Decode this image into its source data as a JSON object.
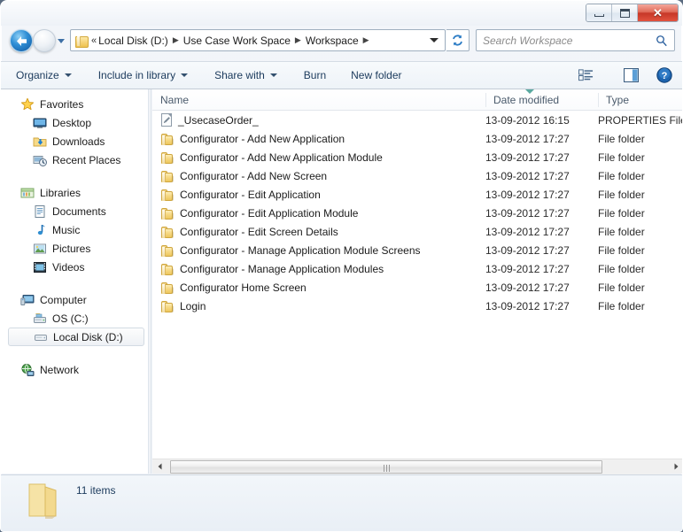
{
  "window": {
    "controls": {
      "minimize": "Minimize",
      "maximize": "Maximize",
      "close": "Close",
      "close_glyph": "✕"
    }
  },
  "address_bar": {
    "back_tooltip": "Back",
    "forward_tooltip": "Forward",
    "overflow_glyph": "«",
    "crumbs": [
      "Local Disk (D:)",
      "Use Case Work Space",
      "Workspace"
    ],
    "separator": "▶",
    "refresh_tooltip": "Refresh"
  },
  "search": {
    "placeholder": "Search Workspace"
  },
  "toolbar": {
    "items": [
      {
        "label": "Organize",
        "has_caret": true
      },
      {
        "label": "Include in library",
        "has_caret": true
      },
      {
        "label": "Share with",
        "has_caret": true
      },
      {
        "label": "Burn",
        "has_caret": false
      },
      {
        "label": "New folder",
        "has_caret": false
      }
    ],
    "view_button": "Change your view",
    "preview_button": "Show the preview pane",
    "help_button": "Get help"
  },
  "nav_pane": {
    "groups": [
      {
        "header": {
          "label": "Favorites",
          "icon": "star-icon"
        },
        "items": [
          {
            "label": "Desktop",
            "icon": "desktop-icon"
          },
          {
            "label": "Downloads",
            "icon": "downloads-icon"
          },
          {
            "label": "Recent Places",
            "icon": "recent-places-icon"
          }
        ]
      },
      {
        "header": {
          "label": "Libraries",
          "icon": "libraries-icon"
        },
        "items": [
          {
            "label": "Documents",
            "icon": "documents-icon"
          },
          {
            "label": "Music",
            "icon": "music-icon"
          },
          {
            "label": "Pictures",
            "icon": "pictures-icon"
          },
          {
            "label": "Videos",
            "icon": "videos-icon"
          }
        ]
      },
      {
        "header": {
          "label": "Computer",
          "icon": "computer-icon"
        },
        "items": [
          {
            "label": "OS (C:)",
            "icon": "system-drive-icon",
            "selected": false
          },
          {
            "label": "Local Disk (D:)",
            "icon": "drive-icon",
            "selected": true
          }
        ]
      },
      {
        "header": {
          "label": "Network",
          "icon": "network-icon"
        },
        "items": []
      }
    ]
  },
  "file_list": {
    "columns": [
      {
        "key": "name",
        "label": "Name",
        "sorted": false
      },
      {
        "key": "date",
        "label": "Date modified",
        "sorted": true
      },
      {
        "key": "type",
        "label": "Type",
        "sorted": false
      }
    ],
    "sort_direction": "ascending",
    "rows": [
      {
        "name": "_UsecaseOrder_",
        "date": "13-09-2012 16:15",
        "type": "PROPERTIES File",
        "icon": "properties-file-icon"
      },
      {
        "name": "Configurator - Add New Application",
        "date": "13-09-2012 17:27",
        "type": "File folder",
        "icon": "folder-icon"
      },
      {
        "name": "Configurator - Add New Application Module",
        "date": "13-09-2012 17:27",
        "type": "File folder",
        "icon": "folder-icon"
      },
      {
        "name": "Configurator - Add New Screen",
        "date": "13-09-2012 17:27",
        "type": "File folder",
        "icon": "folder-icon"
      },
      {
        "name": "Configurator - Edit Application",
        "date": "13-09-2012 17:27",
        "type": "File folder",
        "icon": "folder-icon"
      },
      {
        "name": "Configurator - Edit Application Module",
        "date": "13-09-2012 17:27",
        "type": "File folder",
        "icon": "folder-icon"
      },
      {
        "name": "Configurator - Edit Screen Details",
        "date": "13-09-2012 17:27",
        "type": "File folder",
        "icon": "folder-icon"
      },
      {
        "name": "Configurator - Manage Application Module Screens",
        "date": "13-09-2012 17:27",
        "type": "File folder",
        "icon": "folder-icon"
      },
      {
        "name": "Configurator - Manage Application Modules",
        "date": "13-09-2012 17:27",
        "type": "File folder",
        "icon": "folder-icon"
      },
      {
        "name": "Configurator Home Screen",
        "date": "13-09-2012 17:27",
        "type": "File folder",
        "icon": "folder-icon"
      },
      {
        "name": "Login",
        "date": "13-09-2012 17:27",
        "type": "File folder",
        "icon": "folder-icon"
      }
    ]
  },
  "status_bar": {
    "item_count": "11 items"
  },
  "colors": {
    "accent": "#1b3a5c",
    "close_button": "#c63828",
    "folder": "#f7da88",
    "sort_arrow": "#5aa9a0",
    "selection": "#eef1f5"
  }
}
